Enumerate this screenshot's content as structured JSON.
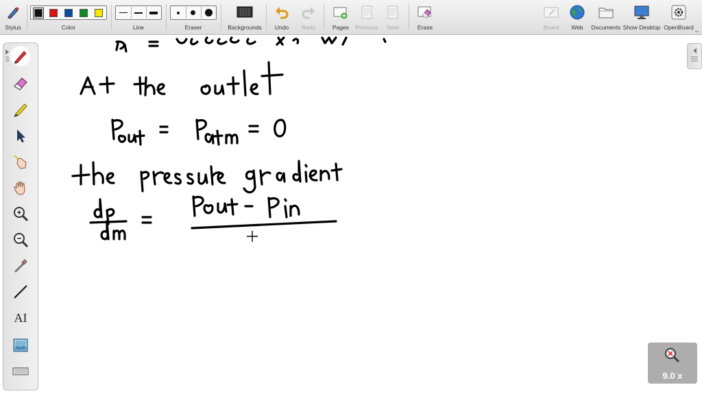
{
  "toolbar": {
    "stylus_label": "Stylus",
    "color_label": "Color",
    "line_label": "Line",
    "eraser_label": "Eraser",
    "backgrounds_label": "Backgrounds",
    "undo_label": "Undo",
    "redo_label": "Redo",
    "pages_label": "Pages",
    "previous_label": "Previous",
    "next_label": "Next",
    "erase_label": "Erase",
    "board_label": "Board",
    "web_label": "Web",
    "documents_label": "Documents",
    "show_desktop_label": "Show Desktop",
    "openboard_label": "OpenBoard",
    "colors": [
      "#111111",
      "#e01010",
      "#0a4a9c",
      "#0d8a20",
      "#f6e600"
    ],
    "selected_color": "#111111"
  },
  "palette": {
    "tools": [
      "pen-icon",
      "eraser-icon",
      "highlighter-icon",
      "pointer-icon",
      "laser-hand-icon",
      "hand-icon",
      "zoom-in-icon",
      "zoom-out-icon",
      "eyedropper-icon",
      "line-tool-icon",
      "text-tool-icon",
      "capture-icon",
      "keyboard-icon"
    ],
    "text_tool_glyph": "AI"
  },
  "zoom": {
    "value_text": "9.0 x"
  },
  "accent": "#2f78d2"
}
